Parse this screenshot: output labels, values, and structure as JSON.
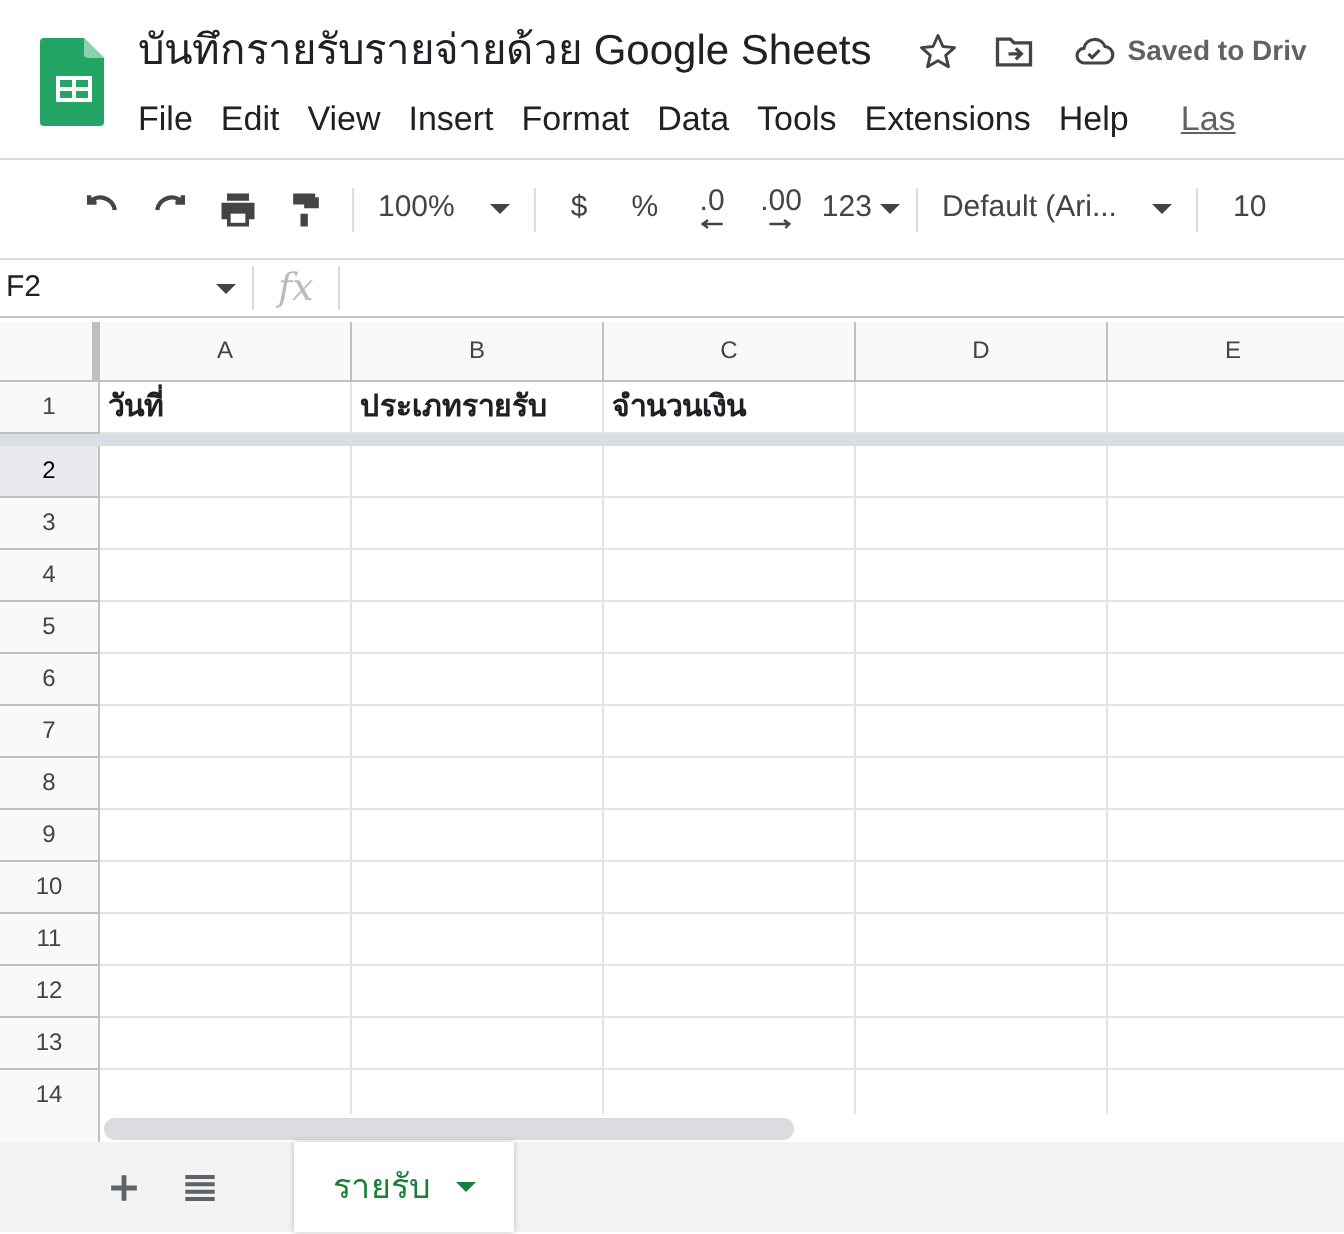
{
  "document": {
    "title": "บันทึกรายรับรายจ่ายด้วย Google Sheets",
    "save_status": "Saved to Driv"
  },
  "menu": [
    "File",
    "Edit",
    "View",
    "Insert",
    "Format",
    "Data",
    "Tools",
    "Extensions",
    "Help"
  ],
  "last_edit_link": "Las",
  "toolbar": [
    {
      "kind": "undo"
    },
    {
      "kind": "redo"
    },
    {
      "kind": "print"
    },
    {
      "kind": "paint"
    },
    {
      "kind": "sep"
    },
    {
      "kind": "zoom",
      "label": "100%"
    },
    {
      "kind": "sep"
    },
    {
      "kind": "currency",
      "label": "$"
    },
    {
      "kind": "percent",
      "label": "%"
    },
    {
      "kind": "decrease",
      "label": ".0"
    },
    {
      "kind": "increase",
      "label": ".00"
    },
    {
      "kind": "format",
      "label": "123"
    },
    {
      "kind": "sep"
    },
    {
      "kind": "font",
      "label": "Default (Ari..."
    },
    {
      "kind": "sep"
    },
    {
      "kind": "size",
      "label": "10"
    }
  ],
  "name_box": "F2",
  "function_label": "fx",
  "columns": [
    "A",
    "B",
    "C",
    "D",
    "E"
  ],
  "rows": [
    {
      "number": "1",
      "selected": false,
      "cells": [
        "วันที่",
        "ประเภทรายรับ",
        "จำนวนเงิน",
        "",
        ""
      ]
    },
    {
      "number": "2",
      "selected": true,
      "cells": [
        "",
        "",
        "",
        "",
        ""
      ]
    },
    {
      "number": "3",
      "selected": false,
      "cells": [
        "",
        "",
        "",
        "",
        ""
      ]
    },
    {
      "number": "4",
      "selected": false,
      "cells": [
        "",
        "",
        "",
        "",
        ""
      ]
    },
    {
      "number": "5",
      "selected": false,
      "cells": [
        "",
        "",
        "",
        "",
        ""
      ]
    },
    {
      "number": "6",
      "selected": false,
      "cells": [
        "",
        "",
        "",
        "",
        ""
      ]
    },
    {
      "number": "7",
      "selected": false,
      "cells": [
        "",
        "",
        "",
        "",
        ""
      ]
    },
    {
      "number": "8",
      "selected": false,
      "cells": [
        "",
        "",
        "",
        "",
        ""
      ]
    },
    {
      "number": "9",
      "selected": false,
      "cells": [
        "",
        "",
        "",
        "",
        ""
      ]
    },
    {
      "number": "10",
      "selected": false,
      "cells": [
        "",
        "",
        "",
        "",
        ""
      ]
    },
    {
      "number": "11",
      "selected": false,
      "cells": [
        "",
        "",
        "",
        "",
        ""
      ]
    },
    {
      "number": "12",
      "selected": false,
      "cells": [
        "",
        "",
        "",
        "",
        ""
      ]
    },
    {
      "number": "13",
      "selected": false,
      "cells": [
        "",
        "",
        "",
        "",
        ""
      ]
    },
    {
      "number": "14",
      "selected": false,
      "cells": [
        "",
        "",
        "",
        "",
        ""
      ]
    }
  ],
  "sheets": [
    {
      "label": "รายรับ",
      "selected": true
    }
  ]
}
